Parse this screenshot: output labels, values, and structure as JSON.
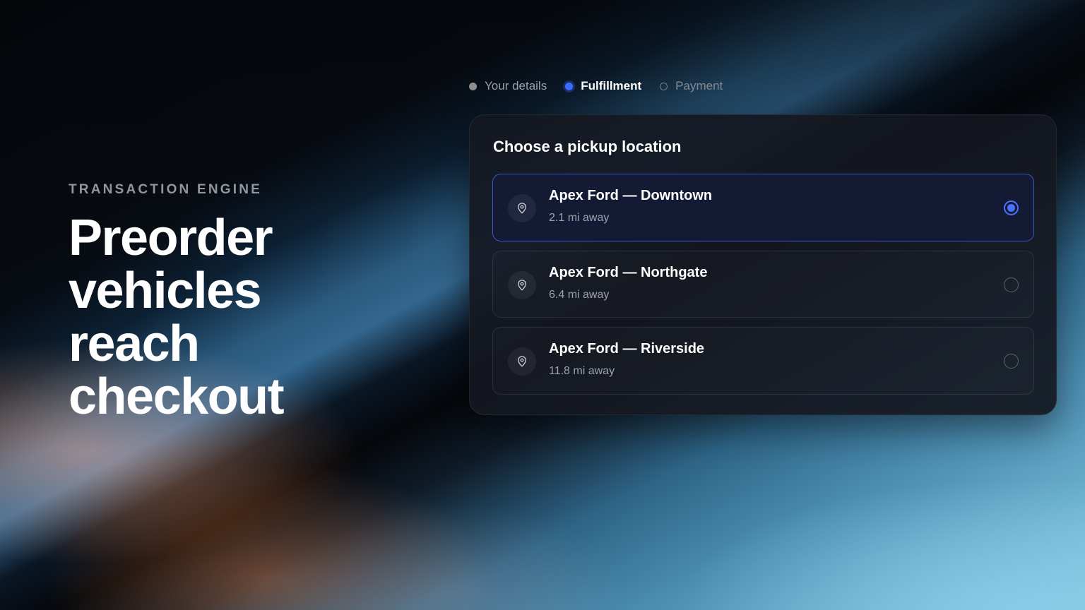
{
  "hero": {
    "eyebrow": "TRANSACTION ENGINE",
    "headline": "Preorder vehicles reach checkout"
  },
  "stepper": {
    "steps": [
      {
        "label": "Your details",
        "state": "done"
      },
      {
        "label": "Fulfillment",
        "state": "active"
      },
      {
        "label": "Payment",
        "state": "pending"
      }
    ]
  },
  "pickup": {
    "title": "Choose a pickup location",
    "icon": "map-pin-icon",
    "options": [
      {
        "name": "Apex Ford — Downtown",
        "distance": "2.1 mi away",
        "selected": true
      },
      {
        "name": "Apex Ford — Northgate",
        "distance": "6.4 mi away",
        "selected": false
      },
      {
        "name": "Apex Ford — Riverside",
        "distance": "11.8 mi away",
        "selected": false
      }
    ]
  },
  "colors": {
    "accent": "#4a72ff",
    "card_bg": "#141820",
    "selected_bg": "#141a33"
  }
}
